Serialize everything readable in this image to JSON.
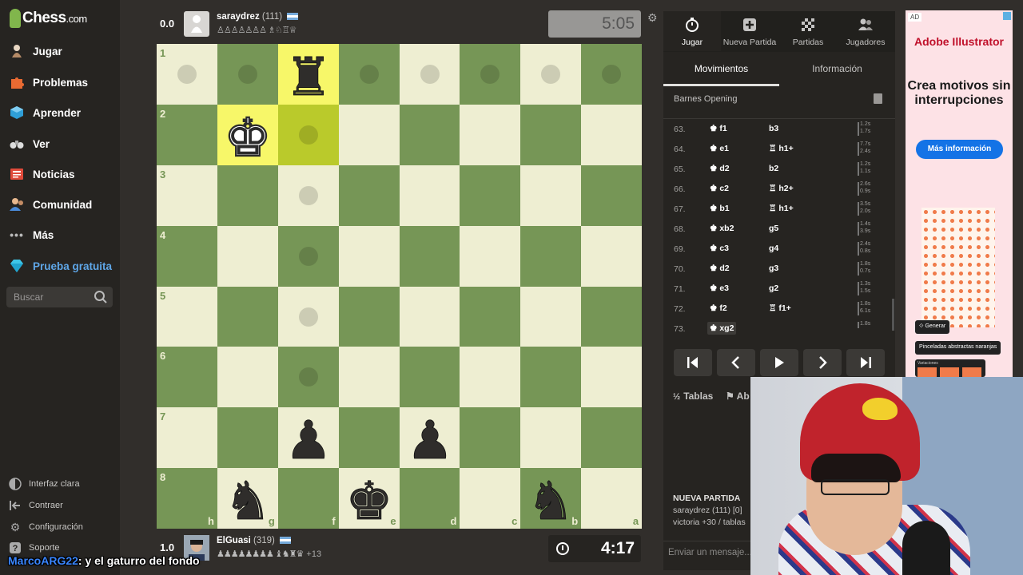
{
  "sidebar": {
    "logo": {
      "main": "Chess",
      "suffix": ".com"
    },
    "nav": [
      {
        "label": "Jugar",
        "icon": "play-pawn-icon"
      },
      {
        "label": "Problemas",
        "icon": "puzzle-icon"
      },
      {
        "label": "Aprender",
        "icon": "learn-cube-icon"
      },
      {
        "label": "Ver",
        "icon": "binoculars-icon"
      },
      {
        "label": "Noticias",
        "icon": "newspaper-icon"
      },
      {
        "label": "Comunidad",
        "icon": "community-icon"
      },
      {
        "label": "Más",
        "icon": "more-dots-icon"
      },
      {
        "label": "Prueba gratuita",
        "icon": "diamond-icon"
      }
    ],
    "search_placeholder": "Buscar",
    "bottom": [
      {
        "label": "Interfaz clara",
        "icon": "theme-icon"
      },
      {
        "label": "Contraer",
        "icon": "collapse-icon"
      },
      {
        "label": "Configuración",
        "icon": "gear-icon"
      },
      {
        "label": "Soporte",
        "icon": "help-icon"
      }
    ]
  },
  "top_player": {
    "score": "0.0",
    "name": "saraydrez",
    "rating": "(111)",
    "captured": "♙♙♙♙♙♙♙ ♗♘♖♕",
    "clock": "5:05"
  },
  "bottom_player": {
    "score": "1.0",
    "name": "ElGuasi",
    "rating": "(319)",
    "captured": "♟♟♟♟♟♟♟♟ ♝♞♜♛",
    "advantage": "+13",
    "clock": "4:17"
  },
  "board": {
    "ranks": [
      "1",
      "2",
      "3",
      "4",
      "5",
      "6",
      "7",
      "8"
    ],
    "files": [
      "h",
      "g",
      "f",
      "e",
      "d",
      "c",
      "b",
      "a"
    ],
    "highlights": [
      [
        0,
        2
      ],
      [
        1,
        2
      ],
      [
        1,
        1
      ]
    ],
    "dots": [
      [
        0,
        0
      ],
      [
        0,
        1
      ],
      [
        0,
        3
      ],
      [
        0,
        4
      ],
      [
        0,
        5
      ],
      [
        0,
        6
      ],
      [
        0,
        7
      ],
      [
        1,
        2
      ],
      [
        2,
        2
      ],
      [
        3,
        2
      ],
      [
        4,
        2
      ],
      [
        5,
        2
      ]
    ],
    "pieces": [
      {
        "row": 0,
        "col": 2,
        "type": "rook",
        "color": "black"
      },
      {
        "row": 1,
        "col": 1,
        "type": "king",
        "color": "white"
      },
      {
        "row": 6,
        "col": 2,
        "type": "pawn",
        "color": "black"
      },
      {
        "row": 6,
        "col": 4,
        "type": "pawn",
        "color": "black"
      },
      {
        "row": 7,
        "col": 1,
        "type": "knight",
        "color": "black"
      },
      {
        "row": 7,
        "col": 3,
        "type": "king",
        "color": "black"
      },
      {
        "row": 7,
        "col": 6,
        "type": "knight",
        "color": "black"
      }
    ]
  },
  "panel": {
    "top_tabs": [
      {
        "label": "Jugar",
        "icon": "stopwatch-icon"
      },
      {
        "label": "Nueva Partida",
        "icon": "plus-square-icon"
      },
      {
        "label": "Partidas",
        "icon": "board-grid-icon"
      },
      {
        "label": "Jugadores",
        "icon": "players-icon"
      }
    ],
    "sub_tabs": [
      "Movimientos",
      "Información"
    ],
    "opening": "Barnes Opening",
    "moves": [
      {
        "num": "63.",
        "white": "f1",
        "black": "b3",
        "white_piece": "♚",
        "black_piece": "",
        "times": [
          "1.2s",
          "1.7s"
        ]
      },
      {
        "num": "64.",
        "white": "e1",
        "black": "h1+",
        "white_piece": "♚",
        "black_piece": "♖",
        "times": [
          "7.7s",
          "2.4s"
        ]
      },
      {
        "num": "65.",
        "white": "d2",
        "black": "b2",
        "white_piece": "♚",
        "black_piece": "",
        "times": [
          "1.2s",
          "1.1s"
        ]
      },
      {
        "num": "66.",
        "white": "c2",
        "black": "h2+",
        "white_piece": "♚",
        "black_piece": "♖",
        "times": [
          "2.6s",
          "0.9s"
        ]
      },
      {
        "num": "67.",
        "white": "b1",
        "black": "h1+",
        "white_piece": "♚",
        "black_piece": "♖",
        "times": [
          "3.5s",
          "2.0s"
        ]
      },
      {
        "num": "68.",
        "white": "xb2",
        "black": "g5",
        "white_piece": "♚",
        "black_piece": "",
        "times": [
          "1.4s",
          "3.9s"
        ]
      },
      {
        "num": "69.",
        "white": "c3",
        "black": "g4",
        "white_piece": "♚",
        "black_piece": "",
        "times": [
          "2.4s",
          "0.8s"
        ]
      },
      {
        "num": "70.",
        "white": "d2",
        "black": "g3",
        "white_piece": "♚",
        "black_piece": "",
        "times": [
          "1.8s",
          "0.7s"
        ]
      },
      {
        "num": "71.",
        "white": "e3",
        "black": "g2",
        "white_piece": "♚",
        "black_piece": "",
        "times": [
          "1.3s",
          "1.5s"
        ]
      },
      {
        "num": "72.",
        "white": "f2",
        "black": "f1+",
        "white_piece": "♚",
        "black_piece": "♖",
        "times": [
          "1.8s",
          "6.1s"
        ]
      },
      {
        "num": "73.",
        "white": "xg2",
        "black": "",
        "white_piece": "♚",
        "black_piece": "",
        "times": [
          "1.8s"
        ]
      }
    ],
    "controls": [
      "first-move-icon",
      "prev-move-icon",
      "play-icon",
      "next-move-icon",
      "last-move-icon"
    ],
    "draw_label": "Tablas",
    "draw_half": "½",
    "abort_label": "Ab",
    "new_game_title": "NUEVA PARTIDA",
    "new_game_line1": "saraydrez (111) [0]",
    "new_game_line2": "victoria +30 / tablas",
    "chat_placeholder": "Enviar un mensaje..."
  },
  "ad": {
    "label": "AD",
    "brand": "Adobe Illustrator",
    "headline": "Crea motivos sin interrupciones",
    "cta": "Más información",
    "chip1": "Generar",
    "chip2": "Pinceladas abstractas naranjas",
    "chip3": "Variaciones"
  },
  "stream_chat": {
    "user": "MarcoARG22",
    "message": ": y el gaturro del fondo"
  },
  "colors": {
    "light_square": "#eeeed2",
    "dark_square": "#769656",
    "highlight_light": "#f7f769",
    "highlight_dark": "#baca2b",
    "brand_green": "#81b64c",
    "trial_blue": "#5fa7e8"
  }
}
